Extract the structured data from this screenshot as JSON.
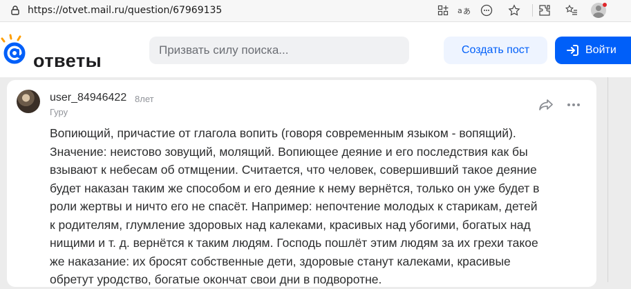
{
  "browser": {
    "url": "https://otvet.mail.ru/question/67969135"
  },
  "header": {
    "logo_text": "ответы",
    "search_placeholder": "Призвать силу поиска...",
    "create_post_label": "Создать пост",
    "login_label": "Войти"
  },
  "answer": {
    "username": "user_84946422",
    "age": "8лет",
    "rank": "Гуру",
    "lines": [
      "Вопиющий, причастие от глагола вопить (говоря современным языком - вопящий).",
      "Значение: неистово зовущий, молящий. Вопиющее деяние и его последствия как бы",
      "взывают к небесам об отмщении. Считается, что человек, совершивший такое деяние",
      "будет наказан таким же способом и его деяние к нему вернётся, только он уже будет в",
      "роли жертвы и ничто его не спасёт. Например: непочтение молодых к старикам, детей",
      "к родителям, глумление здоровых над калеками, красивых над убогими, богатых над",
      "нищими и т. д. вернётся к таким людям. Господь пошлёт этим людям за их грехи такое",
      "же наказание: их бросят собственные дети, здоровые станут калеками, красивые",
      "обретут уродство, богатые окончат свои дни в подворотне."
    ]
  },
  "colors": {
    "brand_blue": "#005ff9",
    "logo_orange": "#ff9e00"
  }
}
